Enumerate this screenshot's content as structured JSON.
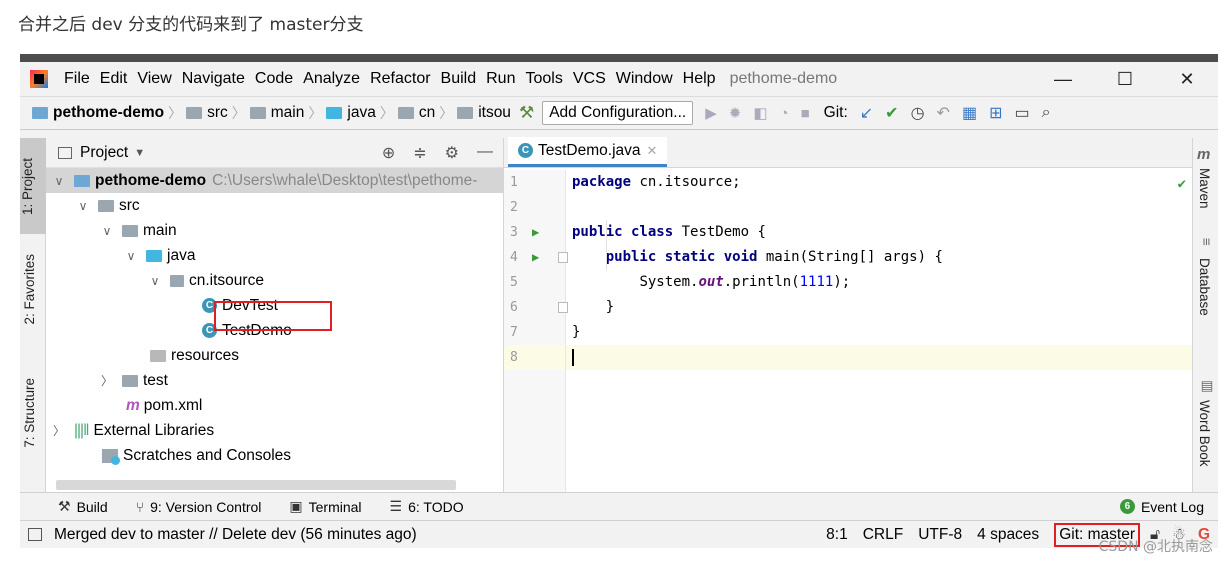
{
  "caption": "合并之后 dev 分支的代码来到了 master分支",
  "menu": {
    "items": [
      "File",
      "Edit",
      "View",
      "Navigate",
      "Code",
      "Analyze",
      "Refactor",
      "Build",
      "Run",
      "Tools",
      "VCS",
      "Window",
      "Help"
    ],
    "project_name": "pethome-demo",
    "minimize": "—",
    "maximize": "☐",
    "close": "✕"
  },
  "navbar": {
    "crumbs": [
      "pethome-demo",
      "src",
      "main",
      "java",
      "cn",
      "itsou"
    ],
    "add_configuration": "Add Configuration...",
    "git_label": "Git:"
  },
  "left_tabs": [
    "1: Project",
    "2: Favorites",
    "7: Structure"
  ],
  "right_tabs": [
    "Maven",
    "Database",
    "Word Book"
  ],
  "project_panel": {
    "header": "Project",
    "tree": {
      "root": "pethome-demo",
      "root_path": "C:\\Users\\whale\\Desktop\\test\\pethome-",
      "src": "src",
      "main": "main",
      "java": "java",
      "package": "cn.itsource",
      "class1": "DevTest",
      "class2": "TestDemo",
      "resources": "resources",
      "test": "test",
      "pom": "pom.xml",
      "ext_libs": "External Libraries",
      "scratches": "Scratches and Consoles"
    }
  },
  "editor": {
    "tab": "TestDemo.java",
    "line_numbers": [
      "1",
      "2",
      "3",
      "4",
      "5",
      "6",
      "7",
      "8"
    ],
    "code": {
      "l1_kw": "package",
      "l1_rest": " cn.itsource;",
      "l3_kw": "public class",
      "l3_rest": " TestDemo {",
      "l4_kw": "public static void",
      "l4_rest": " main(String[] args) {",
      "l5_a": "System.",
      "l5_field": "out",
      "l5_b": ".println(",
      "l5_num": "1111",
      "l5_c": ");",
      "l6": "}",
      "l7": "}"
    }
  },
  "bottom_tools": {
    "build": "Build",
    "version_control": "9: Version Control",
    "terminal": "Terminal",
    "todo": "6: TODO",
    "event_log": "Event Log",
    "event_badge": "6"
  },
  "status": {
    "message": "Merged dev to master // Delete dev (56 minutes ago)",
    "position": "8:1",
    "line_sep": "CRLF",
    "encoding": "UTF-8",
    "indent": "4 spaces",
    "branch": "Git: master"
  },
  "watermark": "CSDN @北执南念",
  "colors": {
    "highlight_box": "#e02020",
    "accent": "#4083c9"
  }
}
